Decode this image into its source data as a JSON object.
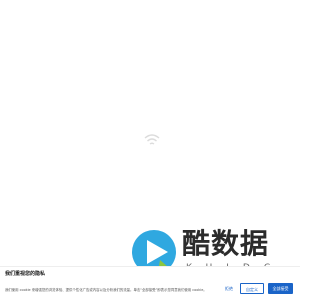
{
  "logo": {
    "cn": "酷数据",
    "en": "KUIDC",
    "colors": {
      "mark_blue": "#2fa8e0",
      "mark_green": "#8cc63f"
    }
  },
  "loader": {
    "icon": "wifi-loading-icon",
    "color": "#d9d9d9"
  },
  "cookie_banner": {
    "title": "我们重视您的隐私",
    "text": "我们使用 cookie 来增强您的浏览体验、提供个性化广告或内容以及分析我们的流量。单击“全部接受”即表示您同意我们使用 cookie。",
    "buttons": {
      "reject": "拒绝",
      "customize": "自定义",
      "accept_all": "全部接受"
    },
    "accent_color": "#1a64c8"
  }
}
